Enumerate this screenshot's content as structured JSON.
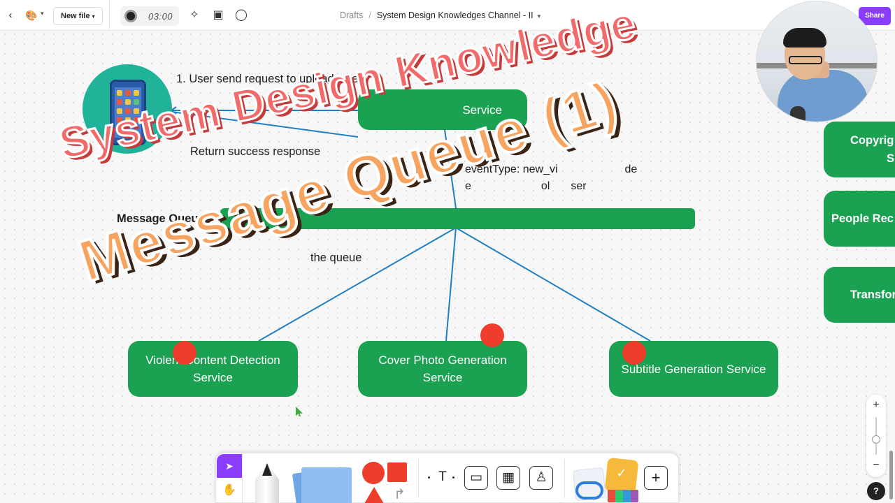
{
  "topbar": {
    "back_icon": "chevron-left-icon",
    "logo_icon": "app-logo-icon",
    "new_file_label": "New file",
    "timer": "03:00",
    "breadcrumb_root": "Drafts",
    "file_title": "System Design Knowledges Channel - II",
    "share_label": "Share"
  },
  "canvas": {
    "step1": "1. User send request to upload video",
    "upload_service_partial": "Service",
    "step2_partial": "Return success response",
    "event_line1_label": "eventType:  new_vi",
    "event_line1_tail": "de",
    "event_line2_head": "e",
    "event_line2_mid": "ol",
    "event_line2_tail": "ser",
    "message_queue_label": "Message Queue",
    "queue_text_partial": "the queue",
    "services": [
      {
        "line1": "Violent Content Detection",
        "line2": "Service"
      },
      {
        "line1": "Cover Photo Generation",
        "line2": "Service"
      },
      {
        "line1": "Subtitle Generation Service",
        "line2": ""
      }
    ],
    "right_cards": [
      {
        "line1": "Copyrig",
        "line2": "S"
      },
      {
        "line1": "People Rec",
        "line2": ""
      },
      {
        "line1": "Transfor",
        "line2": ""
      }
    ]
  },
  "overlay": {
    "title_line1": "System Design Knowledge",
    "title_line2": "Message Queue (1)"
  },
  "zoom": {
    "plus": "+",
    "minus": "−"
  },
  "help_label": "?",
  "toolbar": {
    "select_icon": "pointer-icon",
    "hand_icon": "hand-icon",
    "text_tool": "T",
    "plus_label": "+"
  },
  "colors": {
    "node_green": "#1aa152",
    "accent_purple": "#8b3dff",
    "marker_red": "#ee3d2b",
    "connector_blue": "#1f7fc4"
  }
}
